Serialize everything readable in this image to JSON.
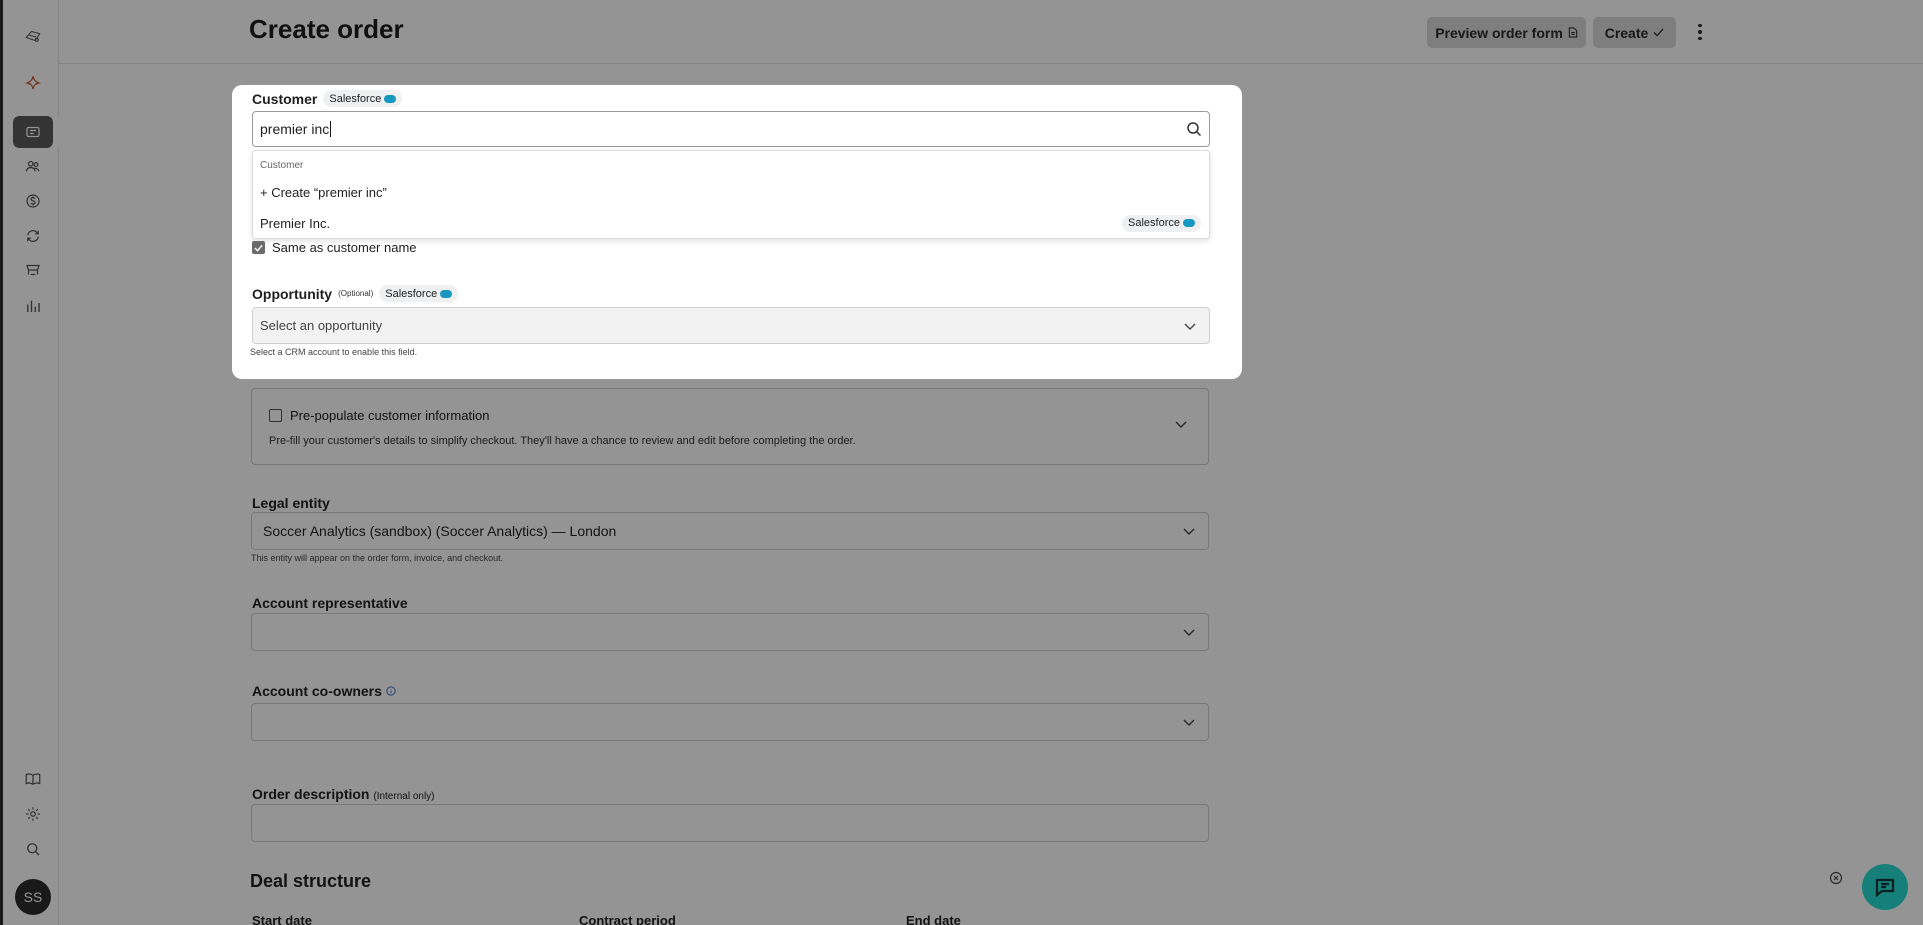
{
  "header": {
    "title": "Create order",
    "preview_label": "Preview order form",
    "create_label": "Create"
  },
  "sidebar": {
    "items": [
      {
        "icon": "logo-icon"
      },
      {
        "icon": "sparkle-icon"
      },
      {
        "icon": "orders-icon"
      },
      {
        "icon": "customers-icon"
      },
      {
        "icon": "billing-icon"
      },
      {
        "icon": "subscriptions-icon"
      },
      {
        "icon": "catalog-icon"
      },
      {
        "icon": "reports-icon"
      },
      {
        "icon": "docs-icon"
      },
      {
        "icon": "settings-icon"
      },
      {
        "icon": "search-icon"
      }
    ],
    "avatar_initials": "SS"
  },
  "modal": {
    "customer_label": "Customer",
    "crm_badge": "Salesforce",
    "search_value": "premier inc",
    "dropdown": {
      "group_label": "Customer",
      "create_option": "+ Create “premier inc”",
      "match_option": "Premier Inc.",
      "match_badge": "Salesforce"
    },
    "same_as_customer": "Same as customer name",
    "opportunity_label": "Opportunity",
    "opportunity_optional": "(Optional)",
    "opportunity_badge": "Salesforce",
    "opportunity_placeholder": "Select an opportunity",
    "opportunity_helper": "Select a CRM account to enable this field."
  },
  "form": {
    "prepopulate_label": "Pre-populate customer information",
    "prepopulate_helper": "Pre-fill your customer's details to simplify checkout. They'll have a chance to review and edit before completing the order.",
    "legal_entity_label": "Legal entity",
    "legal_entity_value": "Soccer Analytics (sandbox) (Soccer Analytics) — London",
    "legal_entity_helper": "This entity will appear on the order form, invoice, and checkout.",
    "account_rep_label": "Account representative",
    "account_coowners_label": "Account co-owners",
    "order_description_label": "Order description",
    "order_description_note": "(Internal only)",
    "deal_structure_title": "Deal structure",
    "start_date_label": "Start date",
    "contract_period_label": "Contract period",
    "end_date_label": "End date"
  },
  "colors": {
    "overlay": "rgba(0,0,0,0.42)",
    "salesforce_blue": "#1798c1",
    "chat_teal": "#167f7a",
    "button_gray": "#d9d9d9"
  }
}
